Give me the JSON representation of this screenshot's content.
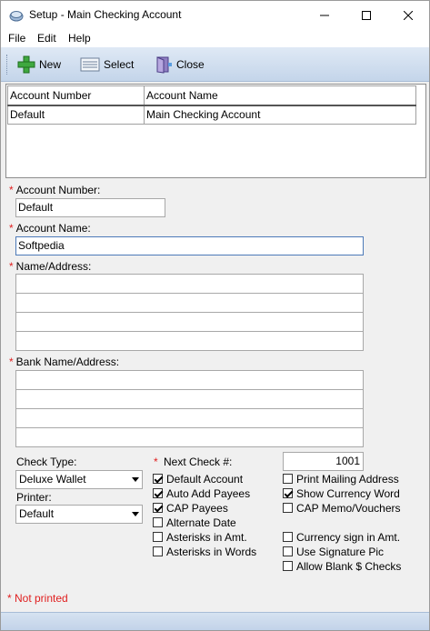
{
  "window": {
    "title": "Setup - Main Checking Account",
    "controls": [
      "minimize",
      "maximize",
      "close"
    ]
  },
  "menu": {
    "file": "File",
    "edit": "Edit",
    "help": "Help"
  },
  "toolbar": {
    "new_label": "New",
    "select_label": "Select",
    "close_label": "Close"
  },
  "grid": {
    "columns": [
      "Account Number",
      "Account Name"
    ],
    "rows": [
      [
        "Default",
        "Main Checking Account"
      ]
    ]
  },
  "form": {
    "account_number_label": "Account Number:",
    "account_number_value": "Default",
    "account_name_label": "Account Name:",
    "account_name_value": "Softpedia",
    "name_address_label": "Name/Address:",
    "bank_address_label": "Bank Name/Address:",
    "check_type_label": "Check Type:",
    "check_type_value": "Deluxe Wallet",
    "printer_label": "Printer:",
    "printer_value": "Default",
    "next_check_label": "Next Check #:",
    "next_check_value": "1001",
    "required_marker": "*"
  },
  "checkboxes": {
    "default_account": {
      "label": "Default Account",
      "checked": true
    },
    "auto_add_payees": {
      "label": "Auto Add Payees",
      "checked": true
    },
    "cap_payees": {
      "label": "CAP Payees",
      "checked": true
    },
    "alternate_date": {
      "label": "Alternate Date",
      "checked": false
    },
    "asterisks_amt": {
      "label": "Asterisks in Amt.",
      "checked": false
    },
    "asterisks_words": {
      "label": "Asterisks in Words",
      "checked": false
    },
    "print_mailing": {
      "label": "Print Mailing Address",
      "checked": false
    },
    "show_currency_word": {
      "label": "Show Currency Word",
      "checked": true
    },
    "cap_memo": {
      "label": "CAP Memo/Vouchers",
      "checked": false
    },
    "currency_sign": {
      "label": "Currency sign in Amt.",
      "checked": false
    },
    "use_signature": {
      "label": "Use Signature Pic",
      "checked": false
    },
    "allow_blank": {
      "label": "Allow Blank $ Checks",
      "checked": false
    }
  },
  "footer": {
    "not_printed": "* Not printed"
  },
  "colors": {
    "required": "#e02020",
    "toolbar_top": "#dfe9f5",
    "toolbar_bottom": "#c4d5ea"
  }
}
